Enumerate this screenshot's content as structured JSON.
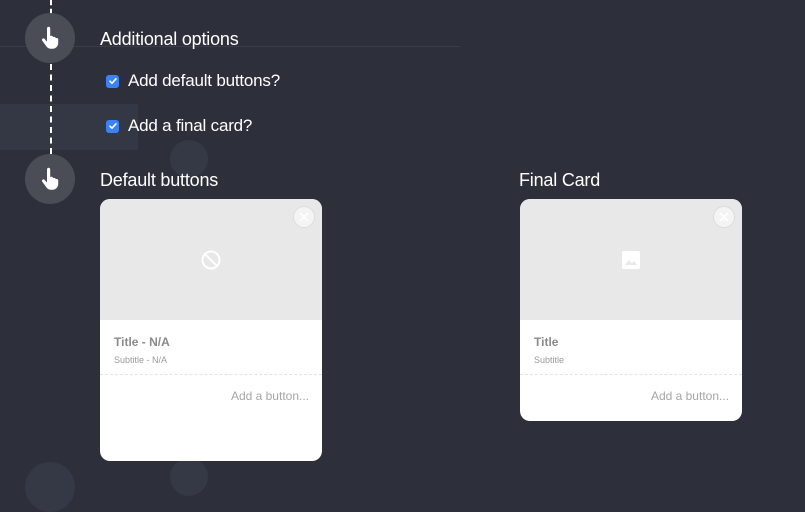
{
  "steps": {
    "additional_options": {
      "title": "Additional options",
      "options": [
        {
          "label": "Add default buttons?",
          "checked": true
        },
        {
          "label": "Add a final card?",
          "checked": true
        }
      ]
    },
    "cards": [
      {
        "section_title": "Default buttons",
        "card_title": "Title - N/A",
        "card_subtitle": "Subtitle - N/A",
        "add_button_label": "Add a button...",
        "image_icon": "no-image-icon"
      },
      {
        "section_title": "Final Card",
        "card_title": "Title",
        "card_subtitle": "Subtitle",
        "add_button_label": "Add a button...",
        "image_icon": "image-icon"
      }
    ]
  },
  "icons": {
    "step_icon": "pointer-hand-icon",
    "close_icon": "close-icon",
    "check_icon": "checkmark-icon"
  },
  "colors": {
    "background": "#2d303a",
    "step_circle": "#4a4d56",
    "checkbox": "#3b82f6",
    "card_image_bg": "#e8e8e8"
  }
}
